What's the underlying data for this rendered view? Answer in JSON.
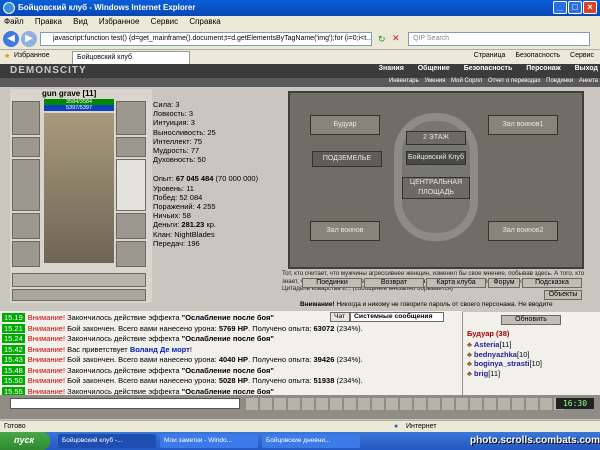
{
  "window": {
    "title": "Бойцовский клуб - Windows Internet Explorer"
  },
  "menu": [
    "Файл",
    "Правка",
    "Вид",
    "Избранное",
    "Сервис",
    "Справка"
  ],
  "address": {
    "url": "javascript:function test() {d=get_mainframe().document;t=d.getElementsByTagName('img');for (i=0;i<t...",
    "search_placeholder": "QIP Search"
  },
  "favorites": {
    "label": "Избранное",
    "tab": "Бойцовский клуб",
    "tools": [
      "Страница",
      "Безопасность",
      "Сервис"
    ]
  },
  "game": {
    "logo": "DEMONSCITY",
    "menu": [
      "Знания",
      "Общение",
      "Безопасность",
      "Персонаж",
      "Выход"
    ],
    "submenu": [
      "Инвентарь",
      "Умения",
      "Мой Сорлл",
      "Отчет о переводах",
      "Поединки",
      "Анкета"
    ],
    "character": {
      "name": "gun grave",
      "level": "[11]",
      "hp": "3584/3584",
      "mana": "5397/5397"
    },
    "stats": [
      {
        "label": "Сила:",
        "value": "3"
      },
      {
        "label": "Ловкость:",
        "value": "3"
      },
      {
        "label": "Интуиция:",
        "value": "3"
      },
      {
        "label": "Выносливость:",
        "value": "25"
      },
      {
        "label": "Интеллект:",
        "value": "75"
      },
      {
        "label": "Мудрость:",
        "value": "77"
      },
      {
        "label": "Духовность:",
        "value": "50"
      }
    ],
    "stats2": [
      {
        "label": "Опыт:",
        "value": "67 045 484",
        "extra": "(70 000 000)"
      },
      {
        "label": "Уровень:",
        "value": "11"
      },
      {
        "label": "Побед:",
        "value": "52 084"
      },
      {
        "label": "Поражений:",
        "value": "4 255"
      },
      {
        "label": "Ничьих:",
        "value": "58"
      },
      {
        "label": "Деньги:",
        "value": "281.23",
        "extra": "кр."
      },
      {
        "label": "Клан:",
        "value": "NightBlades"
      },
      {
        "label": "Передач:",
        "value": "196"
      }
    ],
    "map": {
      "rooms": [
        "Будуар",
        "Зал воинов1",
        "2 ЭТАЖ",
        "ПОДЗЕМЕЛЬЕ",
        "Бойцовский Клуб",
        "ЦЕНТРАЛЬНАЯ ПЛОЩАДЬ",
        "Зал воинов",
        "Зал воинов2"
      ]
    },
    "description": "Тот, кто считает, что мужчины агрессивнее женщин, изменил бы свое мнение, побывав здесь. А того, кто знает, что женщины коварнее мужчин, сюда не затащить и силой. Потому - что это: Будуар в Демонсе. Цитадель коварства и... (сообщение внезапно обрывается)",
    "buttons": [
      "Поединки",
      "Возврат",
      "Карта клуба",
      "Форум",
      "Подсказка",
      "Объекты"
    ],
    "warning": {
      "prefix": "Внимание!",
      "text": "Никогда и никому не говорите пароль от своего персонажа. Не вводите"
    }
  },
  "chat": {
    "tabs": [
      "Чат",
      "Системные сообщения"
    ],
    "messages": [
      {
        "time": "15.19",
        "parts": [
          {
            "t": "Внимание!",
            "c": "red"
          },
          {
            "t": " Закончилось действие эффекта "
          },
          {
            "t": "\"Ослабление после боя\"",
            "c": "b"
          }
        ]
      },
      {
        "time": "15.21",
        "parts": [
          {
            "t": "Внимание!",
            "c": "red"
          },
          {
            "t": " Бой закончен. Всего вами нанесено урона: "
          },
          {
            "t": "5769 HP",
            "c": "b"
          },
          {
            "t": ". Получено опыта: "
          },
          {
            "t": "63072",
            "c": "b"
          },
          {
            "t": " (234%)."
          }
        ]
      },
      {
        "time": "15.24",
        "parts": [
          {
            "t": "Внимание!",
            "c": "red"
          },
          {
            "t": " Закончилось действие эффекта "
          },
          {
            "t": "\"Ослабление после боя\"",
            "c": "b"
          }
        ]
      },
      {
        "time": "15.42",
        "parts": [
          {
            "t": "Внимание!",
            "c": "red"
          },
          {
            "t": " Вас приветствует "
          },
          {
            "t": "Воланд Де морт",
            "c": "blue"
          },
          {
            "t": "!"
          }
        ]
      },
      {
        "time": "15.43",
        "parts": [
          {
            "t": "Внимание!",
            "c": "red"
          },
          {
            "t": " Бой закончен. Всего вами нанесено урона: "
          },
          {
            "t": "4040 HP",
            "c": "b"
          },
          {
            "t": ". Получено опыта: "
          },
          {
            "t": "39426",
            "c": "b"
          },
          {
            "t": " (234%)."
          }
        ]
      },
      {
        "time": "15.48",
        "parts": [
          {
            "t": "Внимание!",
            "c": "red"
          },
          {
            "t": " Закончилось действие эффекта "
          },
          {
            "t": "\"Ослабление после боя\"",
            "c": "b"
          }
        ]
      },
      {
        "time": "15.50",
        "parts": [
          {
            "t": "Внимание!",
            "c": "red"
          },
          {
            "t": " Бой закончен. Всего вами нанесено урона: "
          },
          {
            "t": "5028 HP",
            "c": "b"
          },
          {
            "t": ". Получено опыта: "
          },
          {
            "t": "51938",
            "c": "b"
          },
          {
            "t": " (234%)."
          }
        ]
      },
      {
        "time": "15.55",
        "parts": [
          {
            "t": "Внимание!",
            "c": "red"
          },
          {
            "t": " Закончилось действие эффекта "
          },
          {
            "t": "\"Ослабление после боя\"",
            "c": "b"
          }
        ]
      },
      {
        "time": "15.57",
        "parts": [
          {
            "t": "Внимание!",
            "c": "red"
          },
          {
            "t": " Бой закончен. Всего вами нанесено урона: "
          },
          {
            "t": "5032 HP",
            "c": "b"
          },
          {
            "t": ". Получено опыта: "
          },
          {
            "t": "40439",
            "c": "b"
          },
          {
            "t": " (234%)."
          }
        ]
      }
    ]
  },
  "users": {
    "refresh": "Обновить",
    "room": "Будуар (38)",
    "list": [
      {
        "name": "Asteria",
        "lvl": "[11]"
      },
      {
        "name": "bednyazhka",
        "lvl": "[10]"
      },
      {
        "name": "boginya_strasti",
        "lvl": "[10]"
      },
      {
        "name": "brig",
        "lvl": "[11]"
      }
    ]
  },
  "clock": "16:30",
  "status": {
    "left": "Готово",
    "zone": "Интернет"
  },
  "taskbar": {
    "start": "пуск",
    "tasks": [
      "Бойцовский клуб -...",
      "Мои заметки - Windo...",
      "Бойцовские дневни..."
    ]
  },
  "watermark": "photo.scrolls.combats.com"
}
